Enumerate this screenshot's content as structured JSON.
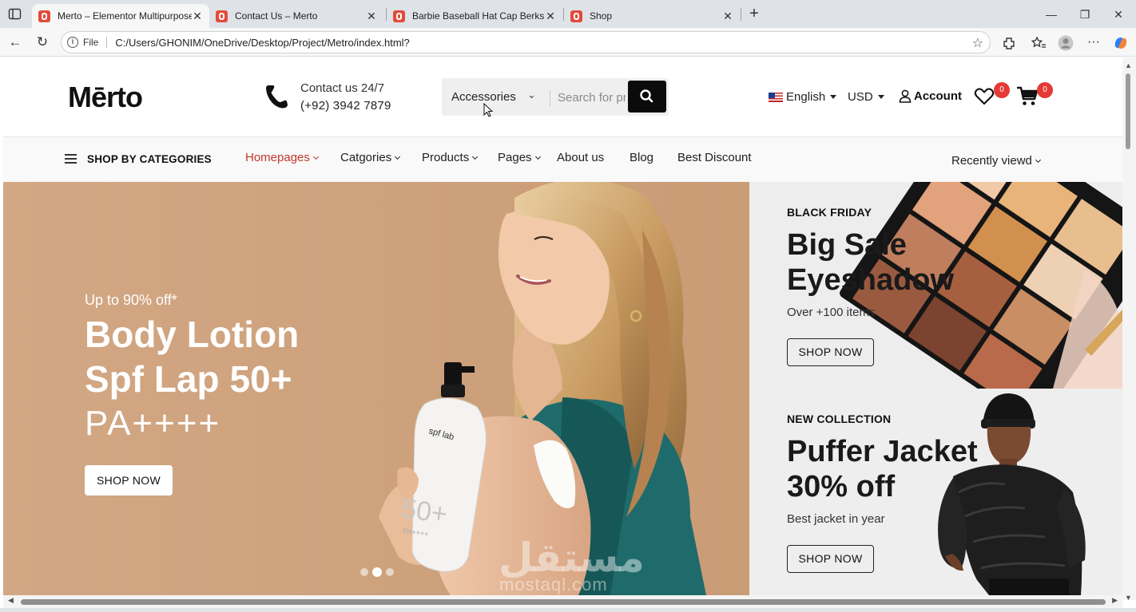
{
  "browser": {
    "tabs": [
      {
        "title": "Merto – Elementor Multipurpose",
        "active": true
      },
      {
        "title": "Contact Us – Merto",
        "active": false
      },
      {
        "title": "Barbie Baseball Hat Cap Berkshire",
        "active": false
      },
      {
        "title": "Shop",
        "active": false
      }
    ],
    "address": {
      "scheme_label": "File",
      "url": "C:/Users/GHONIM/OneDrive/Desktop/Project/Metro/index.html?"
    }
  },
  "header": {
    "logo": "Mērto",
    "contact_label": "Contact us 24/7",
    "contact_phone": "(+92) 3942 7879",
    "search": {
      "category": "Accessories",
      "placeholder": "Search for pr"
    },
    "language": "English",
    "currency": "USD",
    "account": "Account",
    "wishlist_count": "0",
    "cart_count": "0"
  },
  "nav": {
    "categories_label": "SHOP BY CATEGORIES",
    "items": [
      {
        "label": "Homepages",
        "active": true,
        "dropdown": true
      },
      {
        "label": "Catgories",
        "active": false,
        "dropdown": true
      },
      {
        "label": "Products",
        "active": false,
        "dropdown": true
      },
      {
        "label": "Pages",
        "active": false,
        "dropdown": true
      },
      {
        "label": "About us",
        "active": false,
        "dropdown": false
      },
      {
        "label": "Blog",
        "active": false,
        "dropdown": false
      },
      {
        "label": "Best Discount",
        "active": false,
        "dropdown": false
      }
    ],
    "recently_viewed": "Recently viewd"
  },
  "hero": {
    "kicker": "Up to 90% off*",
    "line1": "Body Lotion",
    "line2": "Spf Lap 50+",
    "line3": "PA++++",
    "button": "SHOP NOW",
    "bottle_brand": "spf lab",
    "bottle_spf": "50+",
    "bottle_pa": "PA++++",
    "slides": 3,
    "active_slide": 2
  },
  "promos": [
    {
      "kicker": "BLACK FRIDAY",
      "title_line1": "Big Sale",
      "title_line2": "Eyeshadow",
      "subtitle": "Over +100 items",
      "button": "SHOP NOW"
    },
    {
      "kicker": "NEW COLLECTION",
      "title_line1": "Puffer Jacket",
      "title_line2": "30% off",
      "subtitle": "Best jacket in year",
      "button": "SHOP NOW"
    }
  ],
  "watermark": {
    "arabic": "مستقل",
    "latin": "mostaql.com"
  },
  "colors": {
    "accent": "#c0392b",
    "badge": "#e53935",
    "hero_bg": "#d4a984",
    "search_button": "#0b0b0b"
  }
}
